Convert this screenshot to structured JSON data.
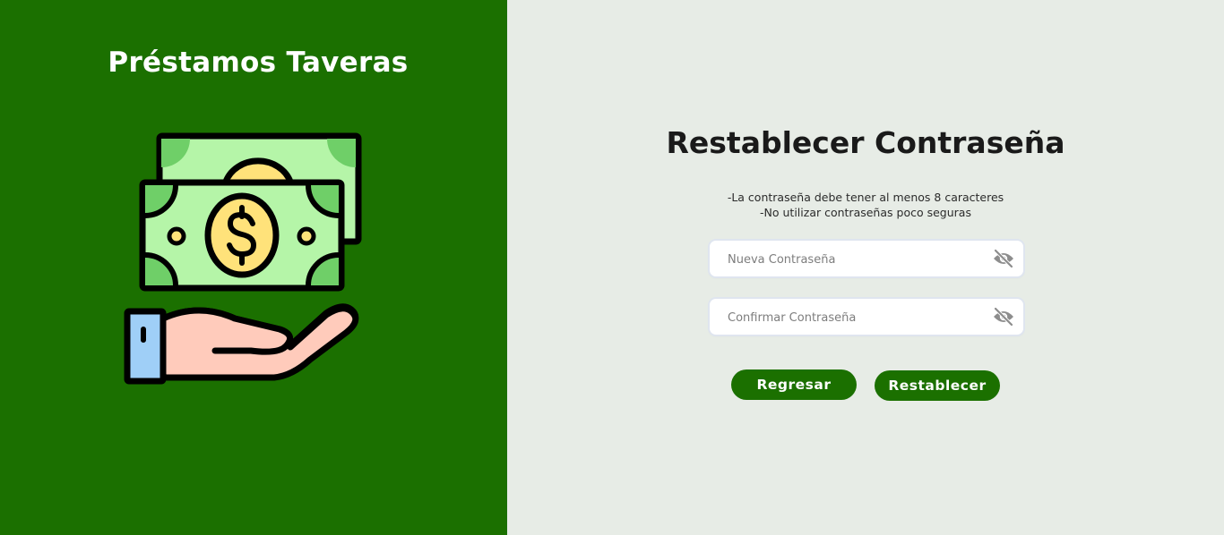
{
  "brand": {
    "title": "Préstamos Taveras"
  },
  "form": {
    "title": "Restablecer Contraseña",
    "rules": [
      "-La contraseña debe tener al menos 8 caracteres",
      "-No utilizar contraseñas poco seguras"
    ],
    "new_password": {
      "value": "",
      "placeholder": "Nueva Contraseña",
      "icon": "eye-off-icon"
    },
    "confirm_password": {
      "value": "",
      "placeholder": "Confirmar Contraseña",
      "icon": "eye-off-icon"
    },
    "back_label": "Regresar",
    "reset_label": "Restablecer"
  },
  "colors": {
    "brand_green": "#1b7000",
    "panel_background": "#e7ece6",
    "bill_green": "#b5f5a8",
    "coin_yellow": "#ffe27a",
    "skin": "#ffcbbb",
    "cuff_blue": "#9fcff7"
  }
}
